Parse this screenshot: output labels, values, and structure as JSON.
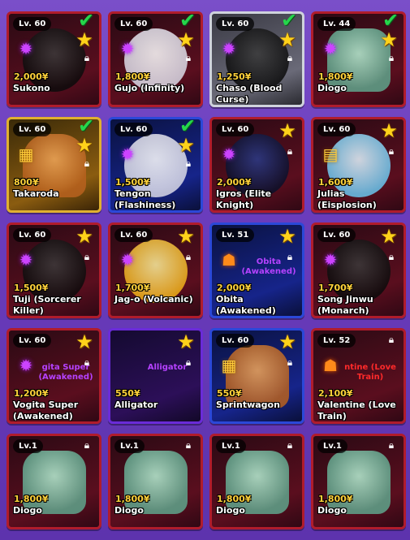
{
  "cards": [
    {
      "level": "Lv. 60",
      "price": "2,000¥",
      "name": "Sukono",
      "glyph": "✹",
      "glyph_color": "purple",
      "art": "dark",
      "rarity": "red",
      "check": true,
      "star": true,
      "lock": true
    },
    {
      "level": "Lv. 60",
      "price": "1,800¥",
      "name": "Gujo (Infinity)",
      "glyph": "✹",
      "glyph_color": "purple",
      "art": "white",
      "rarity": "red",
      "check": true,
      "star": true,
      "lock": true
    },
    {
      "level": "Lv. 60",
      "price": "1,250¥",
      "name": "Chaso (Blood Curse)",
      "glyph": "✹",
      "glyph_color": "purple",
      "art": "dark",
      "rarity": "white",
      "check": true,
      "star": true,
      "lock": true
    },
    {
      "level": "Lv. 44",
      "price": "1,800¥",
      "name": "Diogo",
      "glyph": "✹",
      "glyph_color": "purple",
      "art": "teal",
      "rarity": "red",
      "check": true,
      "star": true,
      "lock": true
    },
    {
      "level": "Lv. 60",
      "price": "800¥",
      "name": "Takaroda",
      "glyph": "▦",
      "glyph_color": "gold",
      "art": "orange",
      "rarity": "gold",
      "check": true,
      "star": true,
      "lock": true
    },
    {
      "level": "Lv. 60",
      "price": "1,500¥",
      "name": "Tengon (Flashiness)",
      "glyph": "✹",
      "glyph_color": "purple",
      "art": "white",
      "rarity": "blue",
      "check": true,
      "star": true,
      "lock": true
    },
    {
      "level": "Lv. 60",
      "price": "2,000¥",
      "name": "Igros (Elite Knight)",
      "glyph": "✹",
      "glyph_color": "purple",
      "art": "blue",
      "rarity": "red",
      "check": false,
      "star": true,
      "lock": true
    },
    {
      "level": "Lv. 60",
      "price": "1,600¥",
      "name": "Julias (Eisplosion)",
      "glyph": "▤",
      "glyph_color": "gold",
      "art": "cyan",
      "rarity": "red",
      "check": false,
      "star": true,
      "lock": true
    },
    {
      "level": "Lv. 60",
      "price": "1,500¥",
      "name": "Tuji (Sorcerer Killer)",
      "glyph": "✹",
      "glyph_color": "purple",
      "art": "dark",
      "rarity": "red",
      "check": false,
      "star": true,
      "lock": true
    },
    {
      "level": "Lv. 60",
      "price": "1,700¥",
      "name": "Jag-o (Volcanic)",
      "glyph": "✹",
      "glyph_color": "purple",
      "art": "yellow",
      "rarity": "red",
      "check": false,
      "star": true,
      "lock": true
    },
    {
      "level": "Lv. 51",
      "price": "2,000¥",
      "name": "Obita (Awakened)",
      "glyph": "☗",
      "glyph_color": "orange",
      "art": "none",
      "rarity": "blue",
      "check": false,
      "star": true,
      "lock": true,
      "overlay": "Obita (Awakened)",
      "overlay_color": "purple"
    },
    {
      "level": "Lv. 60",
      "price": "1,700¥",
      "name": "Song Jinwu (Monarch)",
      "glyph": "✹",
      "glyph_color": "purple",
      "art": "dark",
      "rarity": "red",
      "check": false,
      "star": true,
      "lock": true
    },
    {
      "level": "Lv. 60",
      "price": "1,200¥",
      "name": "Vogita Super (Awakened)",
      "glyph": "✹",
      "glyph_color": "purple",
      "art": "none",
      "rarity": "red",
      "check": false,
      "star": true,
      "lock": true,
      "overlay": "gita Super (Awakened)",
      "overlay_color": "purple"
    },
    {
      "level": "",
      "price": "550¥",
      "name": "Alligator",
      "glyph": "",
      "glyph_color": "purple",
      "art": "none",
      "rarity": "purple",
      "check": false,
      "star": true,
      "lock": true,
      "overlay": "Alligator",
      "overlay_color": "purple"
    },
    {
      "level": "Lv. 60",
      "price": "550¥",
      "name": "Sprintwagon",
      "glyph": "▦",
      "glyph_color": "gold",
      "art": "orange",
      "rarity": "blue",
      "check": false,
      "star": true,
      "lock": true
    },
    {
      "level": "Lv. 52",
      "price": "2,100¥",
      "name": "Valentine (Love Train)",
      "glyph": "☗",
      "glyph_color": "orange",
      "art": "none",
      "rarity": "red",
      "check": false,
      "star": false,
      "lock": true,
      "overlay": "ntine (Love Train)",
      "overlay_color": "red"
    },
    {
      "level": "Lv.1",
      "price": "1,800¥",
      "name": "Diogo",
      "glyph": "",
      "glyph_color": "purple",
      "art": "teal",
      "rarity": "red",
      "check": false,
      "star": false,
      "lock": true
    },
    {
      "level": "Lv.1",
      "price": "1,800¥",
      "name": "Diogo",
      "glyph": "",
      "glyph_color": "purple",
      "art": "teal",
      "rarity": "red",
      "check": false,
      "star": false,
      "lock": true
    },
    {
      "level": "Lv.1",
      "price": "1,800¥",
      "name": "Diogo",
      "glyph": "",
      "glyph_color": "purple",
      "art": "teal",
      "rarity": "red",
      "check": false,
      "star": false,
      "lock": true
    },
    {
      "level": "Lv.1",
      "price": "1,800¥",
      "name": "Diogo",
      "glyph": "",
      "glyph_color": "purple",
      "art": "teal",
      "rarity": "red",
      "check": false,
      "star": false,
      "lock": true
    }
  ],
  "icons": {
    "star": "star-icon",
    "check": "checkmark-icon",
    "lock": "lock-icon"
  },
  "colors": {
    "background": "#6a3cbc",
    "price": "#ffd23a",
    "check": "#25d64b",
    "star": "#ffd21a"
  }
}
